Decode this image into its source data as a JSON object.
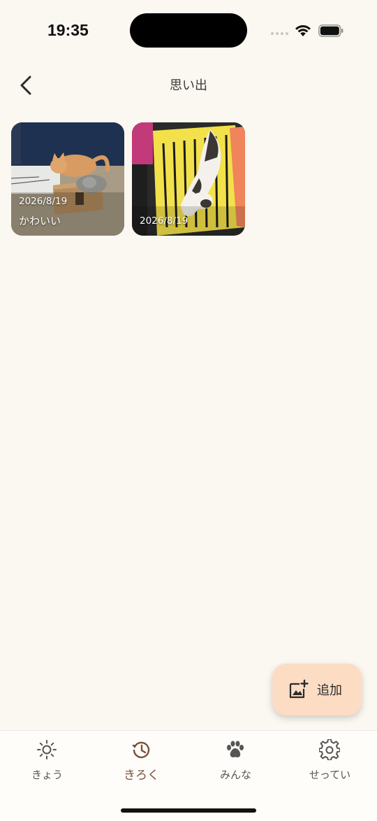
{
  "status_bar": {
    "time": "19:35"
  },
  "header": {
    "title": "思い出"
  },
  "memories": [
    {
      "date": "2026/8/19",
      "caption": "かわいい"
    },
    {
      "date": "2026/8/19",
      "caption": ""
    }
  ],
  "fab": {
    "label": "追加",
    "icon": "add-photo-icon"
  },
  "bottom_nav": {
    "items": [
      {
        "label": "きょう",
        "icon": "sun-icon"
      },
      {
        "label": "きろく",
        "icon": "history-icon",
        "active": true
      },
      {
        "label": "みんな",
        "icon": "paw-icon"
      },
      {
        "label": "せってい",
        "icon": "gear-icon"
      }
    ]
  },
  "colors": {
    "background": "#fbf7f1",
    "fab": "#fddcc4",
    "active_nav": "#7a5037"
  }
}
